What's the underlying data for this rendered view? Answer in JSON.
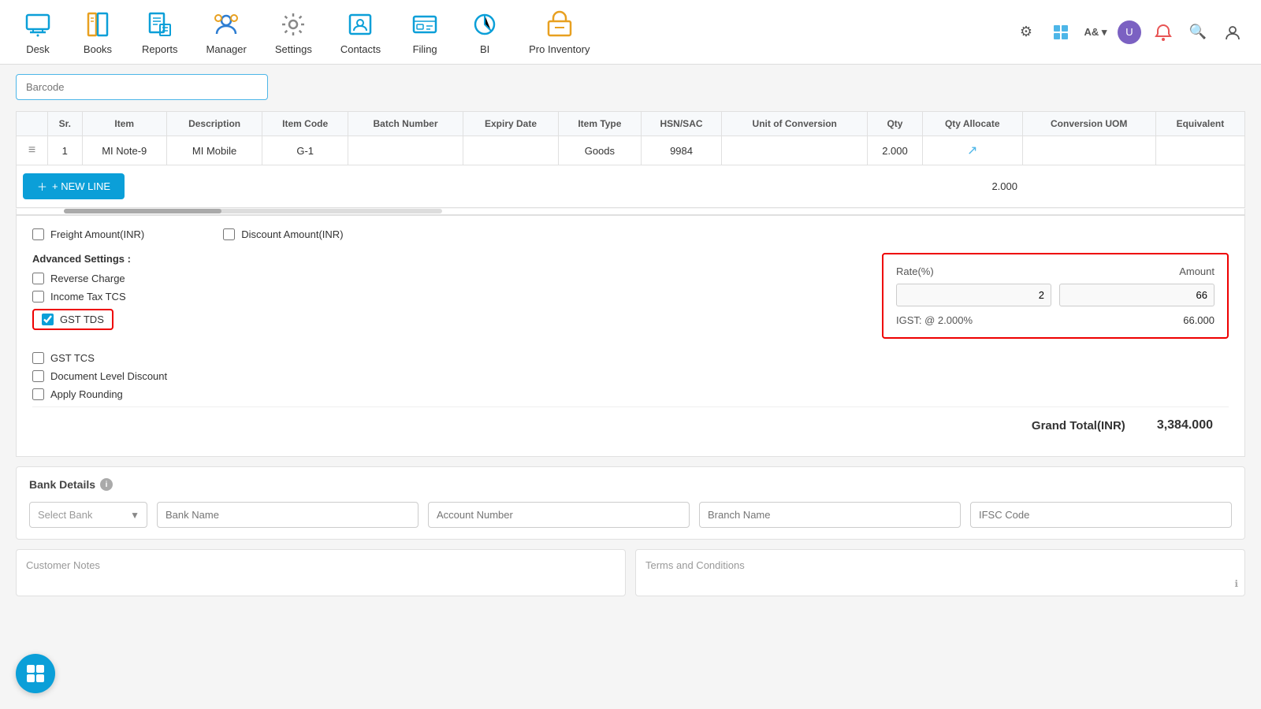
{
  "nav": {
    "items": [
      {
        "id": "desk",
        "label": "Desk",
        "icon": "🖥"
      },
      {
        "id": "books",
        "label": "Books",
        "icon": "📚"
      },
      {
        "id": "reports",
        "label": "Reports",
        "icon": "📊"
      },
      {
        "id": "manager",
        "label": "Manager",
        "icon": "👤"
      },
      {
        "id": "settings",
        "label": "Settings",
        "icon": "⚙"
      },
      {
        "id": "contacts",
        "label": "Contacts",
        "icon": "📇"
      },
      {
        "id": "filing",
        "label": "Filing",
        "icon": "📋"
      },
      {
        "id": "bi",
        "label": "BI",
        "icon": "🔵"
      },
      {
        "id": "pro_inventory",
        "label": "Pro Inventory",
        "icon": "📦"
      }
    ],
    "right_icons": [
      "gear",
      "grid",
      "A&",
      "person",
      "chat",
      "search",
      "bell"
    ]
  },
  "barcode": {
    "placeholder": "Barcode"
  },
  "table": {
    "columns": [
      "Sr.",
      "Item",
      "Description",
      "Item Code",
      "Batch Number",
      "Expiry Date",
      "Item Type",
      "HSN/SAC",
      "Unit of Conversion",
      "Qty",
      "Qty Allocate",
      "Conversion UOM",
      "Equivalent"
    ],
    "rows": [
      {
        "sr": "1",
        "item": "MI Note-9",
        "description": "MI Mobile",
        "item_code": "G-1",
        "batch_number": "",
        "expiry_date": "",
        "item_type": "Goods",
        "hsn_sac": "9984",
        "unit_of_conversion": "",
        "qty": "2.000",
        "qty_allocate": "",
        "conversion_uom": "",
        "equivalent": ""
      }
    ],
    "qty_total": "2.000"
  },
  "new_line_btn": "+ NEW LINE",
  "freight": {
    "label": "Freight Amount(INR)",
    "checked": false
  },
  "discount_amount": {
    "label": "Discount Amount(INR)",
    "checked": false
  },
  "advanced_settings": {
    "title": "Advanced Settings :",
    "items": [
      {
        "id": "reverse_charge",
        "label": "Reverse Charge",
        "checked": false
      },
      {
        "id": "income_tax_tcs",
        "label": "Income Tax TCS",
        "checked": false
      },
      {
        "id": "gst_tds",
        "label": "GST TDS",
        "checked": true
      },
      {
        "id": "gst_tcs",
        "label": "GST TCS",
        "checked": false
      },
      {
        "id": "document_level_discount",
        "label": "Document Level Discount",
        "checked": false
      },
      {
        "id": "apply_rounding",
        "label": "Apply Rounding",
        "checked": false
      }
    ]
  },
  "gst_tds_panel": {
    "rate_label": "Rate(%)",
    "amount_label": "Amount",
    "rate_value": "2",
    "amount_value": "66",
    "summary_label": "IGST: @ 2.000%",
    "summary_value": "66.000"
  },
  "grand_total": {
    "label": "Grand Total(INR)",
    "value": "3,384.000"
  },
  "bank_details": {
    "title": "Bank Details",
    "select_bank_placeholder": "Select Bank",
    "bank_name_placeholder": "Bank Name",
    "account_number_placeholder": "Account Number",
    "branch_name_placeholder": "Branch Name",
    "ifsc_placeholder": "IFSC Code"
  },
  "notes": {
    "customer_notes_placeholder": "Customer Notes",
    "terms_placeholder": "Terms and Conditions"
  }
}
